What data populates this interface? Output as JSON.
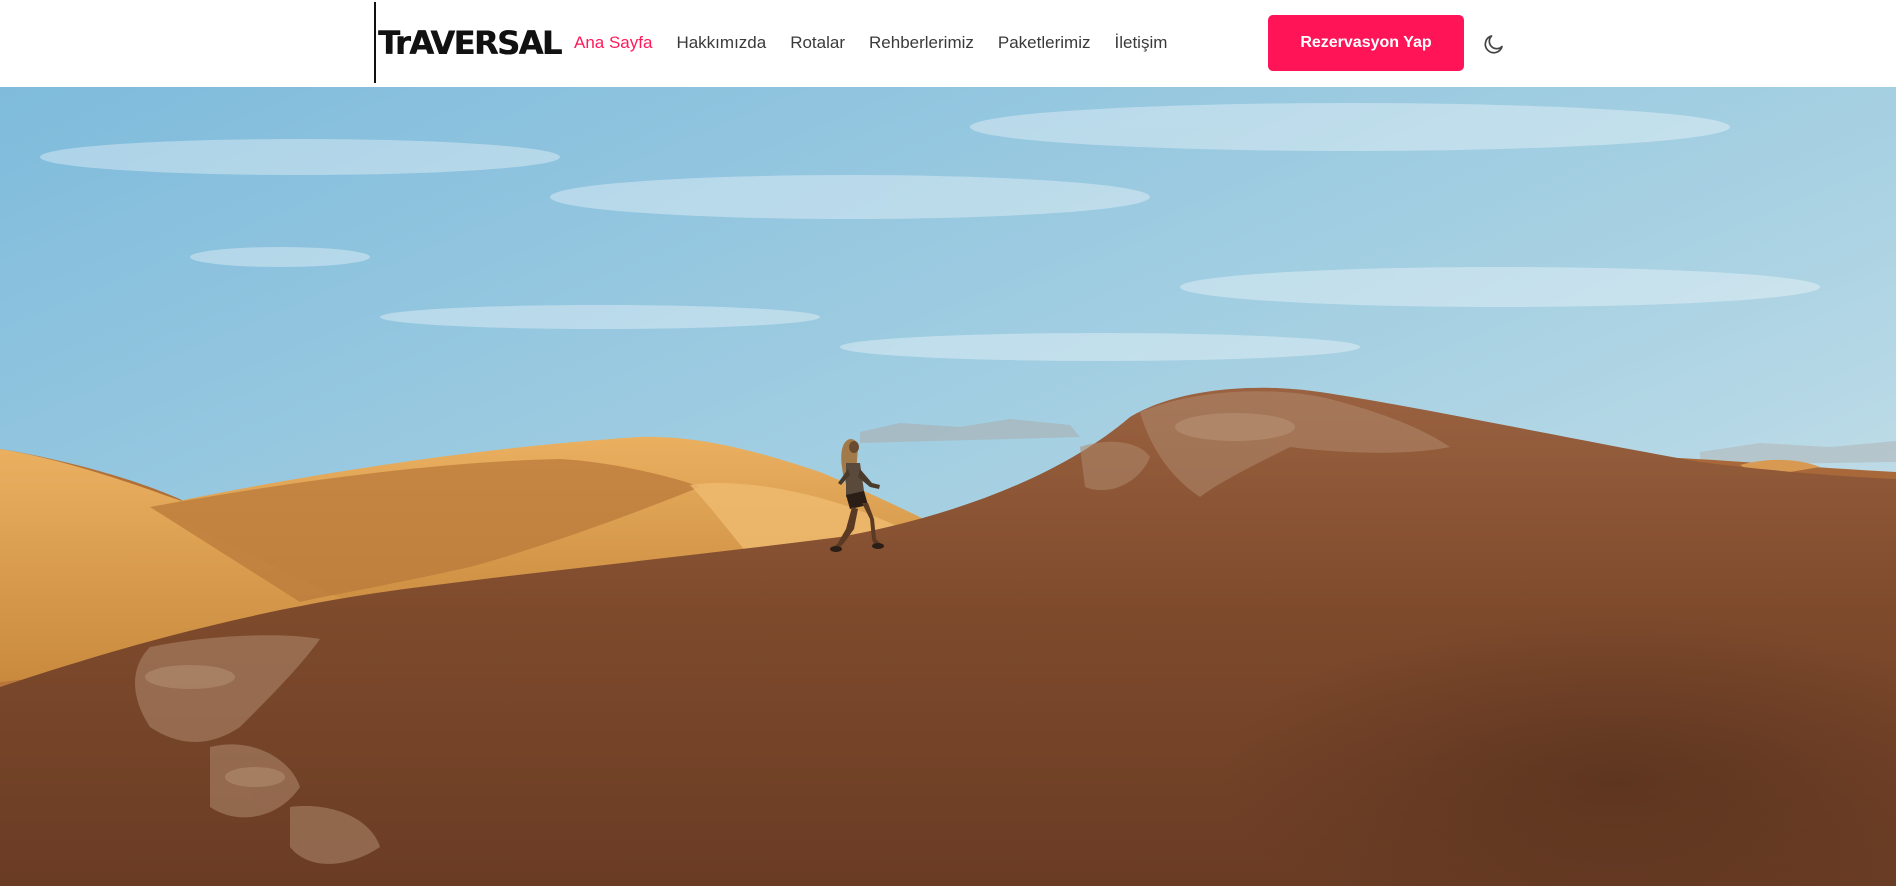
{
  "brand": {
    "logo_text": "TrAVERSAL"
  },
  "nav": {
    "items": [
      {
        "label": "Ana Sayfa",
        "active": true
      },
      {
        "label": "Hakkımızda",
        "active": false
      },
      {
        "label": "Rotalar",
        "active": false
      },
      {
        "label": "Rehberlerimiz",
        "active": false
      },
      {
        "label": "Paketlerimiz",
        "active": false
      },
      {
        "label": "İletişim",
        "active": false
      }
    ]
  },
  "cta": {
    "label": "Rezervasyon Yap"
  },
  "theme_toggle": {
    "icon": "moon-icon"
  },
  "hero": {
    "image": "person-walking-on-desert-dune-ridge"
  },
  "colors": {
    "accent": "#ff1458",
    "active_link": "#ff1a5a",
    "nav_text": "#3a3a3a",
    "sky": "#8cc3df",
    "sand_light": "#e3a54f",
    "sand_dark": "#8a5430"
  }
}
